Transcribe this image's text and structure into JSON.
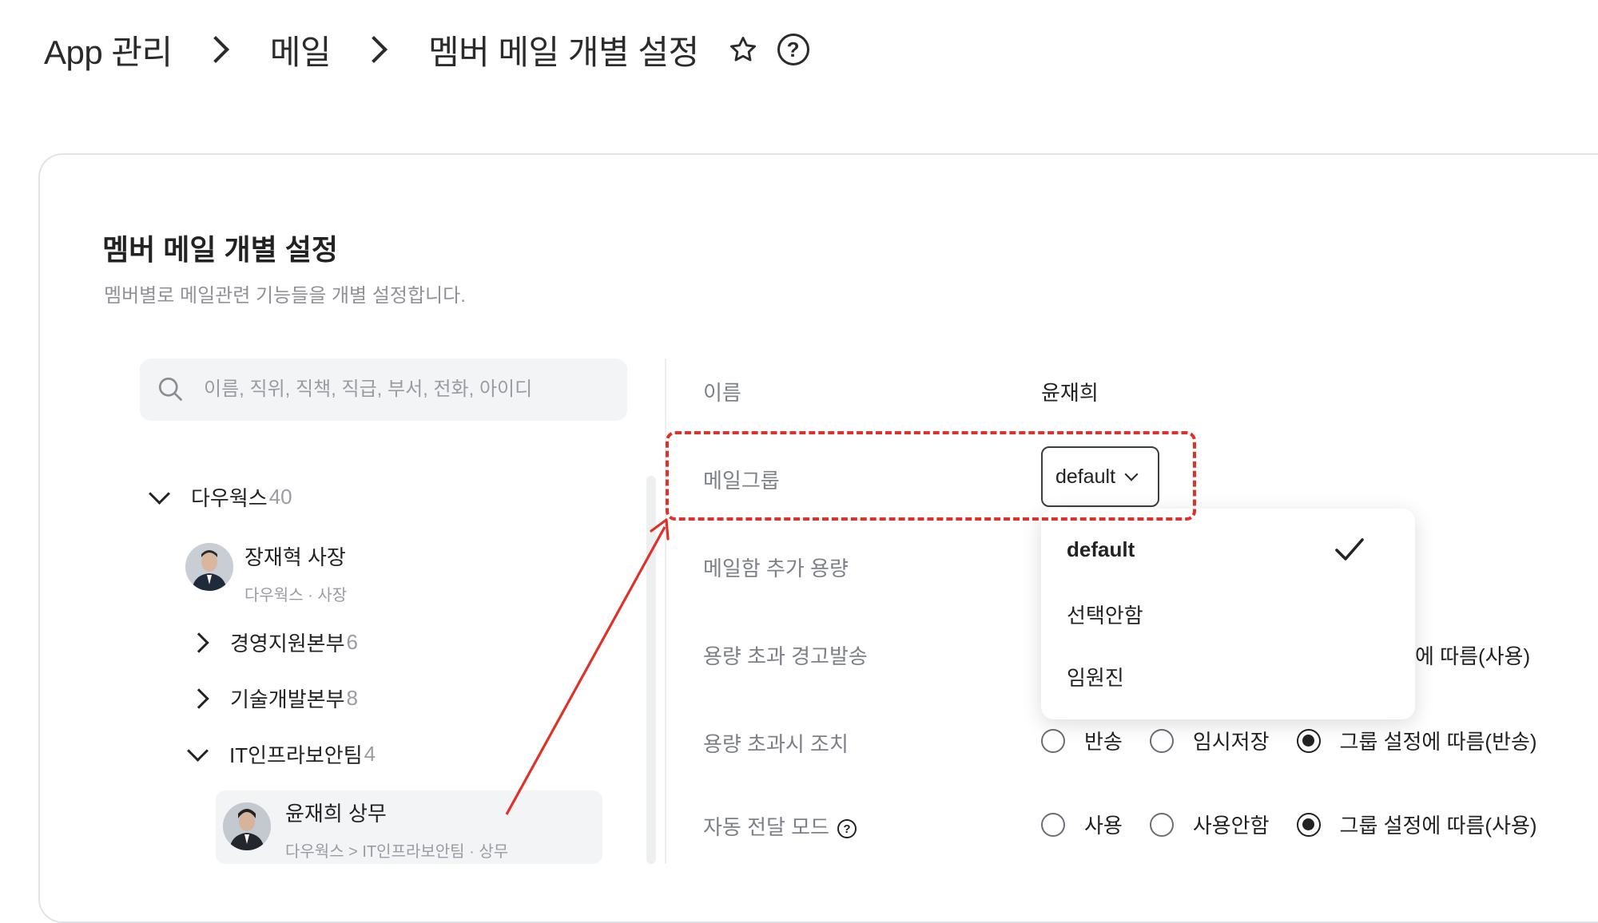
{
  "breadcrumb": {
    "items": [
      "App 관리",
      "메일",
      "멤버 메일 개별 설정"
    ],
    "star_icon": "star-outline-icon",
    "help_icon": "help-circle-icon",
    "help_glyph": "?"
  },
  "card": {
    "title": "멤버 메일 개별 설정",
    "description": "멤버별로 메일관련 기능들을 개별 설정합니다."
  },
  "search": {
    "placeholder": "이름, 직위, 직책, 직급, 부서, 전화, 아이디",
    "icon": "search-icon"
  },
  "tree": {
    "root": {
      "name": "다우웍스",
      "count": "40"
    },
    "ceo": {
      "name": "장재혁 사장",
      "sub": "다우웍스 · 사장"
    },
    "departments": [
      {
        "name": "경영지원본부",
        "count": "6"
      },
      {
        "name": "기술개발본부",
        "count": "8"
      },
      {
        "name": "IT인프라보안팀",
        "count": "4"
      }
    ],
    "selected_member": {
      "name": "윤재희 상무",
      "sub": "다우웍스 > IT인프라보안팀 · 상무"
    }
  },
  "form": {
    "name_label": "이름",
    "name_value": "윤재희",
    "group_label": "메일그룹",
    "group_value": "default",
    "quota_label": "메일함 추가 용량",
    "over_warn_label": "용량 초과 경고발송",
    "over_warn_partial": "에 따름(사용)",
    "over_action_label": "용량 초과시 조치",
    "over_action_options": [
      "반송",
      "임시저장",
      "그룹 설정에 따름(반송)"
    ],
    "over_action_selected": 2,
    "auto_forward_label": "자동 전달 모드",
    "auto_forward_options": [
      "사용",
      "사용안함",
      "그룹 설정에 따름(사용)"
    ],
    "auto_forward_selected": 2,
    "help_glyph": "?"
  },
  "dropdown": {
    "options": [
      "default",
      "선택안함",
      "임원진"
    ],
    "selected": 0,
    "check_icon": "check-icon"
  },
  "colors": {
    "annotation": "#e0302a",
    "text_primary": "#222222",
    "text_secondary": "#7d8086",
    "surface": "#f3f4f6"
  }
}
